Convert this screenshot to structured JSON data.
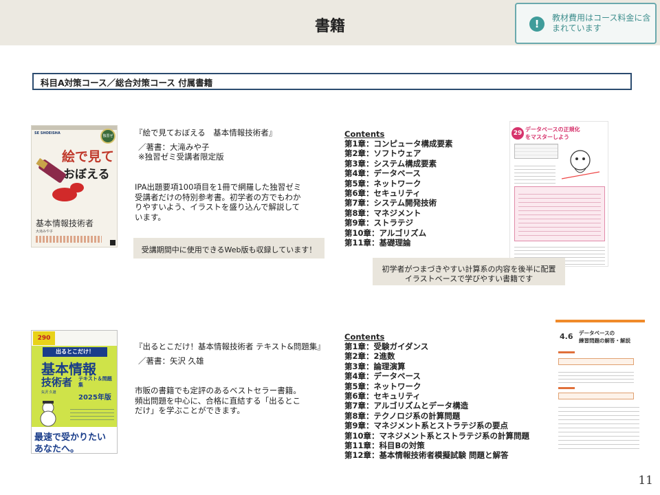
{
  "header": {
    "title": "書籍"
  },
  "notice": {
    "icon": "exclamation-icon",
    "icon_glyph": "!",
    "text": "教材費用はコース料金に含まれています"
  },
  "section": {
    "title": "科目A対策コース／総合対策コース 付属書籍"
  },
  "books": [
    {
      "title": "『絵で見ておぼえる　基本情報技術者』",
      "author": "／著書：大滝みや子",
      "note": "※独習ゼミ受講者限定版",
      "description": "IPA出題要項100項目を1冊で網羅した独習ゼミ受講者だけの特別参考書。初学者の方でもわかりやすいよう、イラストを盛り込んで解説しています。",
      "callout": "受講期間中に使用できるWeb版も収録しています！",
      "cover": {
        "publisher": "SE SHOEISHA",
        "badge": "独習ゼミ",
        "title_line1": "絵で見て",
        "title_line2": "おぼえる",
        "subject": "基本情報技術者",
        "author": "大滝みや子"
      },
      "contents_heading": "Contents",
      "contents": [
        "第1章：コンピュータ構成要素",
        "第2章：ソフトウェア",
        "第3章：システム構成要素",
        "第4章：データベース",
        "第5章：ネットワーク",
        "第6章：セキュリティ",
        "第7章：システム開発技術",
        "第8章：マネジメント",
        "第9章：ストラテジ",
        "第10章：アルゴリズム",
        "第11章：基礎理論"
      ],
      "sample": {
        "number": "29",
        "heading_line1": "データベースの正規化",
        "heading_line2": "をマスターしよう"
      },
      "sample_callout_line1": "初学者がつまづきやすい計算系の内容を後半に配置",
      "sample_callout_line2": "イラストベースで学びやすい書籍です"
    },
    {
      "title": "『出るとこだけ！基本情報技術者 テキスト&問題集』",
      "author": "／著書：矢沢 久雄",
      "description": "市販の書籍でも定評のあるベストセラー書籍。頻出問題を中心に、合格に直結する「出るとこだけ」を学ぶことができます。",
      "cover": {
        "price_label": "290",
        "top_banner": "出るとこだけ！",
        "title_line1": "基本情報",
        "title_line2": "技術者",
        "subtitle": "テキスト＆問題集",
        "year": "2025年版",
        "author": "矢沢 久雄",
        "slogan_line1": "最速で受かりたい",
        "slogan_line2": "あなたへ。"
      },
      "contents_heading": "Contents",
      "contents": [
        "第1章：受験ガイダンス",
        "第2章：2進数",
        "第3章：論理演算",
        "第4章：データベース",
        "第5章：ネットワーク",
        "第6章：セキュリティ",
        "第7章：アルゴリズムとデータ構造",
        "第8章：テクノロジ系の計算問題",
        "第9章：マネジメント系とストラテジ系の要点",
        "第10章：マネジメント系とストラテジ系の計算問題",
        "第11章：科目Bの対策",
        "第12章：基本情報技術者模擬試験 問題と解答"
      ],
      "sample": {
        "number": "4.6",
        "heading_line1": "データベースの",
        "heading_line2": "練習問題の解答・解説"
      }
    }
  ],
  "page_number": "11",
  "colors": {
    "header_bg": "#ece9e1",
    "accent_teal": "#3f9c9a",
    "section_border": "#2b4b6f",
    "callout_bg": "#e9e5dc"
  }
}
